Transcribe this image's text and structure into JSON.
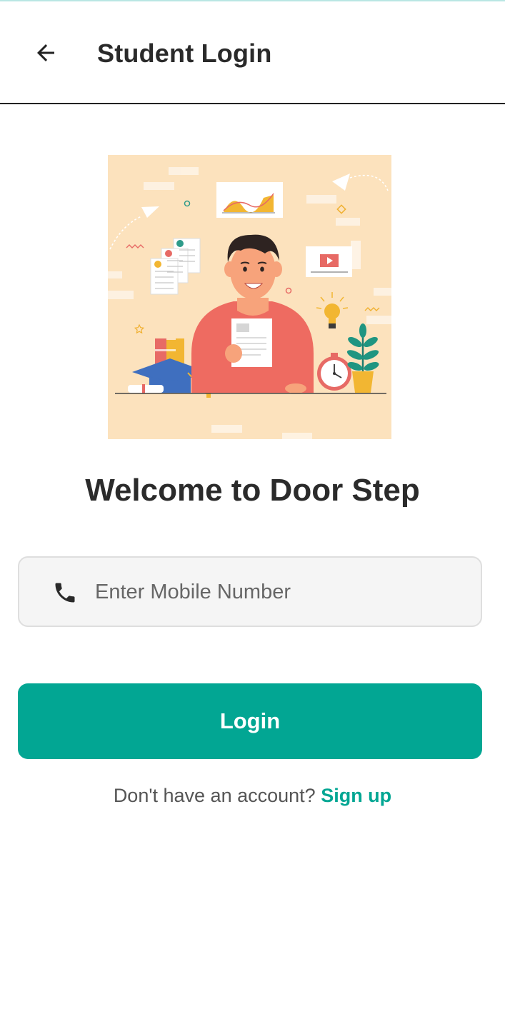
{
  "header": {
    "title": "Student Login",
    "back_icon": "arrow-left-icon"
  },
  "hero": {
    "illustration": "student-holding-paper-illustration"
  },
  "welcome_text": "Welcome to Door Step",
  "phone": {
    "icon": "phone-icon",
    "placeholder": "Enter Mobile Number",
    "value": ""
  },
  "login": {
    "label": "Login"
  },
  "signup": {
    "prompt": "Don't have an account?",
    "link_label": "Sign up"
  },
  "colors": {
    "accent": "#02a693",
    "hero_bg": "#fce2bd",
    "shirt": "#ee6b61"
  }
}
